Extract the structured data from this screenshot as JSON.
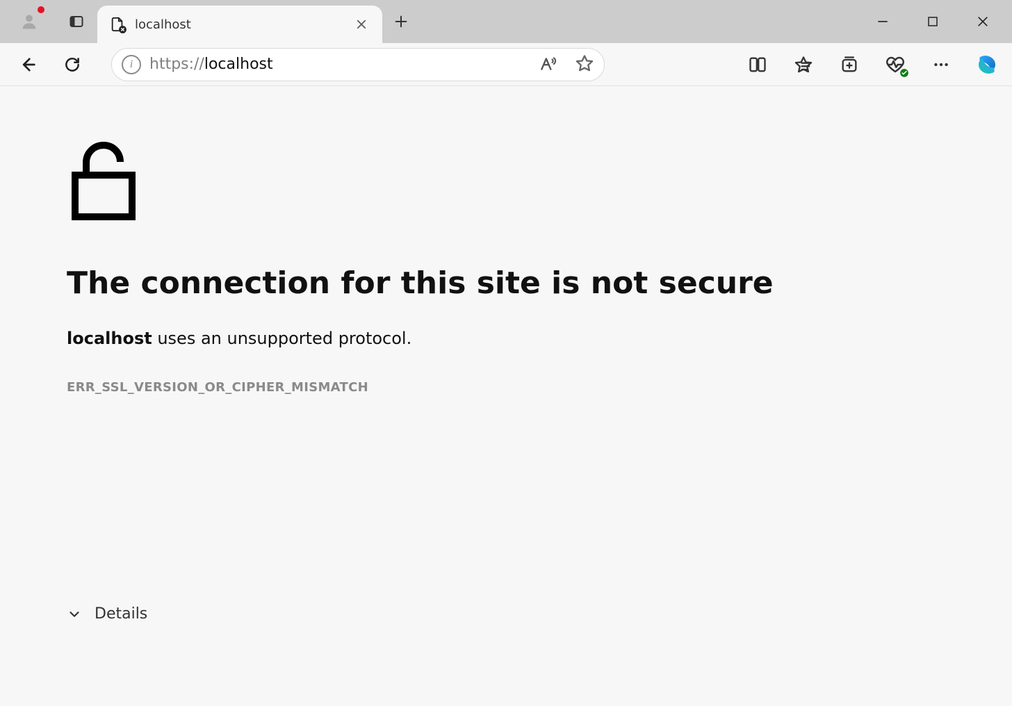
{
  "tab": {
    "title": "localhost"
  },
  "address": {
    "scheme": "https://",
    "host": "localhost"
  },
  "error": {
    "heading": "The connection for this site is not secure",
    "host_bold": "localhost",
    "message_tail": " uses an unsupported protocol.",
    "code": "ERR_SSL_VERSION_OR_CIPHER_MISMATCH",
    "details_label": "Details"
  }
}
